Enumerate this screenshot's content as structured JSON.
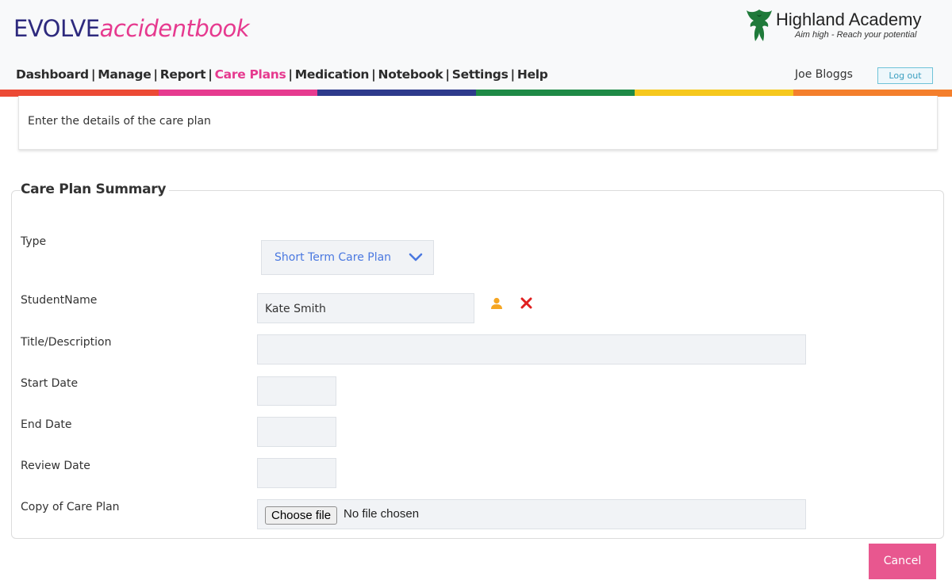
{
  "brand": {
    "part1": "EVOLVE",
    "part2": "accidentbook"
  },
  "school": {
    "name": "Highland Academy",
    "motto": "Aim high - Reach your potential"
  },
  "nav": {
    "items": [
      {
        "label": "Dashboard",
        "active": false
      },
      {
        "label": "Manage",
        "active": false
      },
      {
        "label": "Report",
        "active": false
      },
      {
        "label": "Care Plans",
        "active": true
      },
      {
        "label": "Medication",
        "active": false
      },
      {
        "label": "Notebook",
        "active": false
      },
      {
        "label": "Settings",
        "active": false
      },
      {
        "label": "Help",
        "active": false
      }
    ],
    "separator": "|",
    "user": "Joe Bloggs",
    "logout": "Log out"
  },
  "colors": {
    "brand_primary": "#2e2a7e",
    "brand_accent": "#e63a8f",
    "rainbow": [
      "#ec4a35",
      "#e63a8f",
      "#2e3a8c",
      "#1e8a46",
      "#f6c81d",
      "#f47f2c"
    ],
    "cancel_button": "#e8578f",
    "select_text": "#4a78e0"
  },
  "intro": {
    "text": "Enter the details of the care plan"
  },
  "form": {
    "legend": "Care Plan Summary",
    "type_label": "Type",
    "type_value": "Short Term Care Plan",
    "student_label": "StudentName",
    "student_value": "Kate Smith",
    "title_label": "Title/Description",
    "title_value": "",
    "start_label": "Start Date",
    "start_value": "",
    "end_label": "End Date",
    "end_value": "",
    "review_label": "Review Date",
    "review_value": "",
    "file_label": "Copy of Care Plan",
    "file_button": "Choose file",
    "file_status": "No file chosen"
  },
  "icons": {
    "person": "person-icon",
    "remove": "close-icon",
    "dropdown": "chevron-down-icon",
    "crest": "eagle-crest-icon"
  },
  "actions": {
    "cancel": "Cancel"
  }
}
